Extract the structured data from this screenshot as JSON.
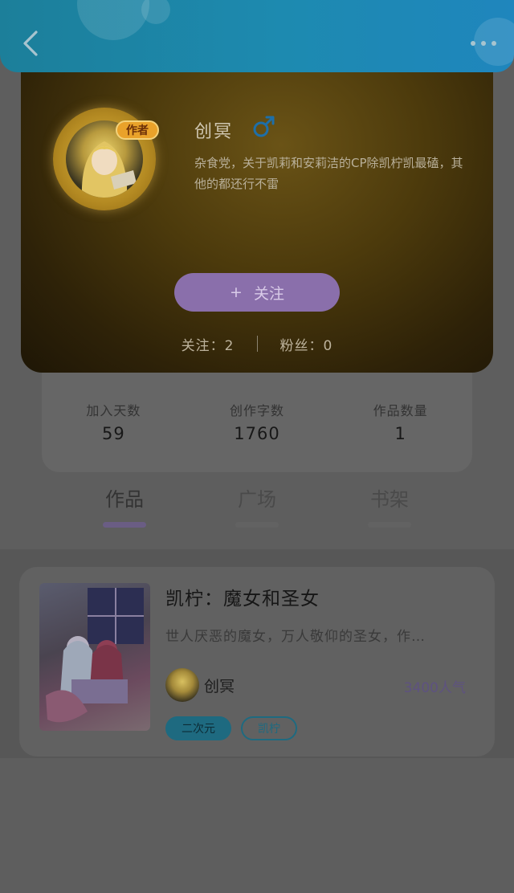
{
  "header": {
    "back_icon": "chevron-left-icon",
    "more_icon": "ellipsis-icon",
    "background_color": "#1d8ab0"
  },
  "profile": {
    "badge": "作者",
    "name": "创冥",
    "gender_icon": "male-icon",
    "bio": "杂食党，关于凯莉和安莉洁的CP除凯柠凯最磕，其他的都还行不雷",
    "follow_button": "关注",
    "follow_plus": "+",
    "following_text": "关注：2",
    "fans_text": "粉丝：0"
  },
  "stats": {
    "items": [
      {
        "label": "加入天数",
        "value": "59"
      },
      {
        "label": "创作字数",
        "value": "1760"
      },
      {
        "label": "作品数量",
        "value": "1"
      }
    ]
  },
  "tabs": [
    {
      "label": "作品",
      "active": true
    },
    {
      "label": "广场",
      "active": false
    },
    {
      "label": "书架",
      "active": false
    }
  ],
  "work": {
    "title": "凯柠：魔女和圣女",
    "description": "世人厌恶的魔女，万人敬仰的圣女，作…",
    "author": "创冥",
    "popularity": "3400人气",
    "tags": [
      "二次元",
      "凯柠"
    ]
  },
  "colors": {
    "accent_purple": "#8a6fab",
    "tag_teal": "#1e6a80"
  }
}
